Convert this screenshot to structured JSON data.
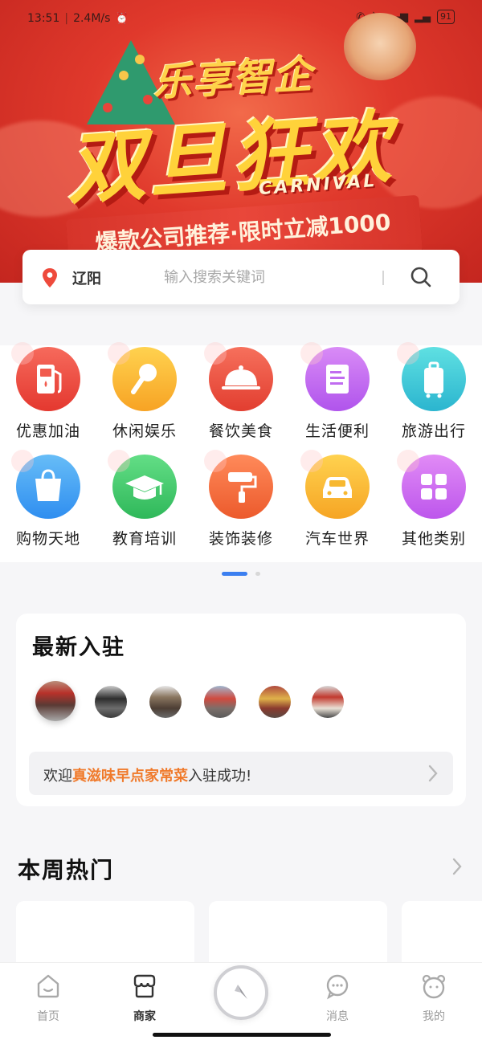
{
  "status_bar": {
    "time": "13:51",
    "speed": "2.4M/s",
    "battery": "91"
  },
  "banner": {
    "headline_small": "乐享智企",
    "headline_big": "双旦狂欢",
    "subtitle": "CARNIVAL",
    "promo": "爆款公司推荐·限时立减1000"
  },
  "search": {
    "city": "辽阳",
    "placeholder": "输入搜索关键词"
  },
  "categories": [
    {
      "label": "优惠加油",
      "icon": "fuel-pump-icon",
      "color": "#ef4a3f"
    },
    {
      "label": "休闲娱乐",
      "icon": "microphone-icon",
      "color": "#f8b52c"
    },
    {
      "label": "餐饮美食",
      "icon": "food-cloche-icon",
      "color": "#f05a46"
    },
    {
      "label": "生活便利",
      "icon": "document-icon",
      "color": "#c06cf0"
    },
    {
      "label": "旅游出行",
      "icon": "suitcase-icon",
      "color": "#38c9d6"
    },
    {
      "label": "购物天地",
      "icon": "shopping-bag-icon",
      "color": "#3ba1f3"
    },
    {
      "label": "教育培训",
      "icon": "graduation-cap-icon",
      "color": "#3ecb6a"
    },
    {
      "label": "装饰装修",
      "icon": "paint-roller-icon",
      "color": "#f36b3b"
    },
    {
      "label": "汽车世界",
      "icon": "car-icon",
      "color": "#f8b52c"
    },
    {
      "label": "其他类别",
      "icon": "grid-icon",
      "color": "#d46ef0"
    }
  ],
  "new_arrivals": {
    "title": "最新入驻",
    "message_prefix": "欢迎",
    "message_highlight": "真滋味早点家常菜",
    "message_suffix": "入驻成功!",
    "highlight_color": "#f07a2b"
  },
  "weekly_hot": {
    "title": "本周热门"
  },
  "tabbar": {
    "tabs": [
      {
        "label": "首页",
        "icon": "home-icon"
      },
      {
        "label": "商家",
        "icon": "store-icon"
      },
      {
        "label": "",
        "icon": "compass-icon"
      },
      {
        "label": "消息",
        "icon": "message-icon"
      },
      {
        "label": "我的",
        "icon": "profile-icon"
      }
    ]
  },
  "colors": {
    "accent": "#3b7ff0",
    "banner_red": "#e0392c"
  }
}
